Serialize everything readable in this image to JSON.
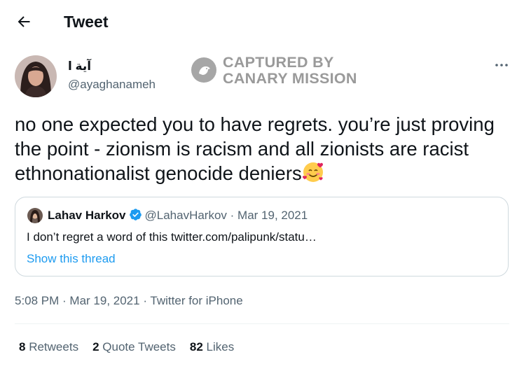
{
  "header": {
    "title": "Tweet",
    "back_icon": "arrow-left-icon"
  },
  "author": {
    "display_name": "آية ا",
    "handle": "@ayaghanameh"
  },
  "watermark": {
    "line1": "CAPTURED BY",
    "line2": "CANARY MISSION"
  },
  "tweet": {
    "text": "no one expected you to have regrets. you’re just proving the point - zionism is racism and all zionists are racist ethnonationalist genocide deniers",
    "emoji": "smiling-face-with-hearts"
  },
  "quote": {
    "name": "Lahav Harkov",
    "handle": "@LahavHarkov",
    "separator": " · ",
    "date": "Mar 19, 2021",
    "text": "I don’t regret a word of this twitter.com/palipunk/statu…",
    "show_thread": "Show this thread"
  },
  "meta": {
    "time": "5:08 PM",
    "sep": " · ",
    "date": "Mar 19, 2021",
    "source": "Twitter for iPhone"
  },
  "stats": {
    "retweets_count": "8",
    "retweets_label": "Retweets",
    "quotes_count": "2",
    "quotes_label": "Quote Tweets",
    "likes_count": "82",
    "likes_label": "Likes"
  },
  "colors": {
    "accent": "#1d9bf0",
    "text": "#0f1419",
    "secondary": "#536471",
    "border": "#cfd9de",
    "watermark": "#9a9a9a"
  }
}
